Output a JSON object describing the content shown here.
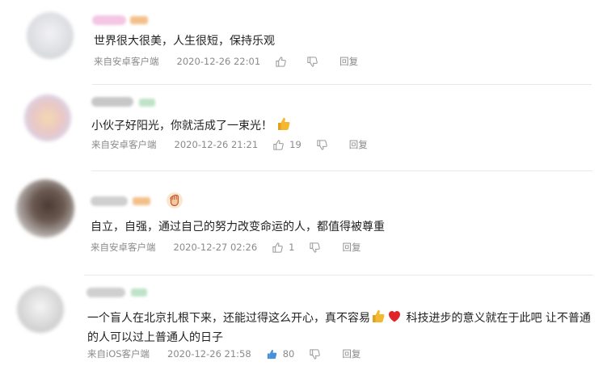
{
  "comments": [
    {
      "text": "世界很大很美，人生很短，保持乐观",
      "source": "来自安卓客户端",
      "time": "2020-12-26 22:01",
      "likes": "",
      "reply": "回复",
      "liked": false
    },
    {
      "text": "小伙子好阳光，你就活成了一束光！",
      "emoji": "thumbs-up",
      "source": "来自安卓客户端",
      "time": "2020-12-26 21:21",
      "likes": "19",
      "reply": "回复",
      "liked": false
    },
    {
      "header_emoji": "raised-fist",
      "text": "自立，自强，通过自己的努力改变命运的人，都值得被尊重",
      "source": "来自安卓客户端",
      "time": "2020-12-27 02:26",
      "likes": "1",
      "reply": "回复",
      "liked": false
    },
    {
      "text_part1": "一个盲人在北京扎根下来，还能过得这么开心，真不容易",
      "emojis": [
        "thumbs-up",
        "red-heart"
      ],
      "text_part2": " 科技进步的意义就在于此吧 让不普通",
      "text_line2": "的人可以过上普通人的日子",
      "source": "来自iOS客户端",
      "time": "2020-12-26 21:58",
      "likes": "80",
      "reply": "回复",
      "liked": true
    }
  ],
  "colors": {
    "like_active": "#4a90d9",
    "meta": "#8a8a8a",
    "heart": "#e0242b",
    "thumb": "#f5b630"
  }
}
